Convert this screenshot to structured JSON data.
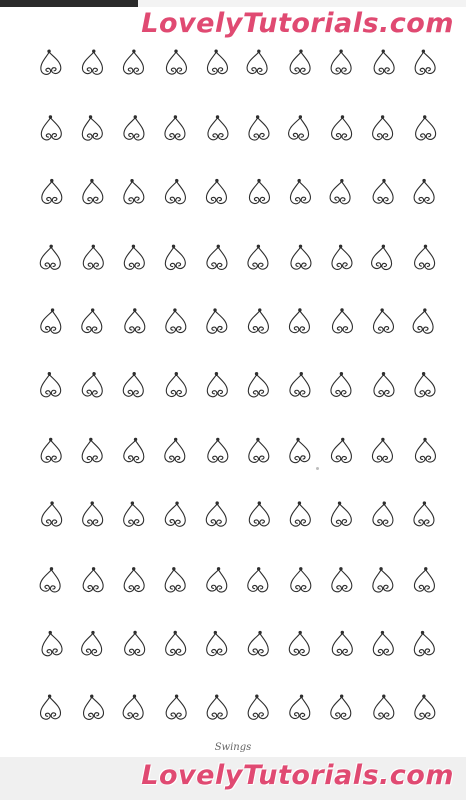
{
  "watermark": {
    "text": "LovelyTutorials.com",
    "color": "#e04a72"
  },
  "caption": "Swings",
  "pattern": {
    "rows": 11,
    "columns": 10,
    "motif": "heart-swirl-swing",
    "ink_color": "#2e2e2e"
  }
}
